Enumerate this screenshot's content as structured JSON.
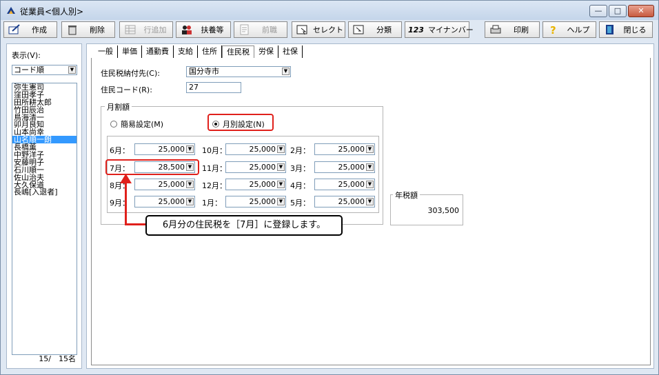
{
  "window": {
    "title": "従業員<個人別>",
    "controls": {
      "minimize": "—",
      "maximize": "□",
      "close": "✕"
    }
  },
  "toolbar": {
    "buttons": [
      {
        "name": "create-button",
        "label": "作成",
        "icon": "create-icon",
        "disabled": false
      },
      {
        "name": "delete-button",
        "label": "削除",
        "icon": "trash-icon",
        "disabled": false
      },
      {
        "name": "add-row-button",
        "label": "行追加",
        "icon": "grid-icon",
        "disabled": true
      },
      {
        "name": "dependents-button",
        "label": "扶養等",
        "icon": "people-icon",
        "disabled": false
      },
      {
        "name": "previous-job-button",
        "label": "前職",
        "icon": "document-icon",
        "disabled": true
      },
      {
        "name": "select-button",
        "label": "セレクト",
        "icon": "select-icon",
        "disabled": false
      },
      {
        "name": "classify-button",
        "label": "分類",
        "icon": "classify-icon",
        "disabled": false
      },
      {
        "name": "my-number-button",
        "label": "マイナンバー",
        "icon": "my-number-icon",
        "disabled": false
      },
      {
        "name": "print-button",
        "label": "印刷",
        "icon": "printer-icon",
        "disabled": false
      },
      {
        "name": "help-button",
        "label": "ヘルプ",
        "icon": "help-icon",
        "disabled": false
      },
      {
        "name": "close-button",
        "label": "閉じる",
        "icon": "exit-icon",
        "disabled": false
      }
    ],
    "my_number_prefix": "123"
  },
  "left": {
    "display_label": "表示(V):",
    "sort_value": "コード順",
    "employees": [
      "弥生憲司",
      "窪田孝子",
      "田所耕太郎",
      "竹田辰治",
      "鳥海清一",
      "卯月良知",
      "山本尚幸",
      "山名順一朗",
      "長橋薫",
      "中野洋子",
      "安藤明子",
      "石川順一",
      "佐山治夫",
      "大久保道",
      "長嶋[入退者]"
    ],
    "selected_index": 7,
    "count": "15/　15名"
  },
  "tabs": [
    "一般",
    "単価",
    "通勤費",
    "支給",
    "住所",
    "住民税",
    "労保",
    "社保"
  ],
  "active_tab": 5,
  "form": {
    "payee_label": "住民税納付先(C):",
    "payee_value": "国分寺市",
    "code_label": "住民コード(R):",
    "code_value": "27",
    "monthly_group": "月割額",
    "radio_simple": "簡易設定(M)",
    "radio_monthly": "月別設定(N)",
    "selected_radio": "monthly",
    "annual_group": "年税額",
    "annual_value": "303,500"
  },
  "months": [
    {
      "label": "6月：",
      "value": "25,000"
    },
    {
      "label": "7月：",
      "value": "28,500"
    },
    {
      "label": "8月：",
      "value": "25,000"
    },
    {
      "label": "9月：",
      "value": "25,000"
    },
    {
      "label": "10月：",
      "value": "25,000"
    },
    {
      "label": "11月：",
      "value": "25,000"
    },
    {
      "label": "12月：",
      "value": "25,000"
    },
    {
      "label": "1月：",
      "value": "25,000"
    },
    {
      "label": "2月：",
      "value": "25,000"
    },
    {
      "label": "3月：",
      "value": "25,000"
    },
    {
      "label": "4月：",
      "value": "25,000"
    },
    {
      "label": "5月：",
      "value": "25,000"
    }
  ],
  "annotation": {
    "text": "6月分の住民税を［7月］に登録します。",
    "color": "#e0201b"
  }
}
